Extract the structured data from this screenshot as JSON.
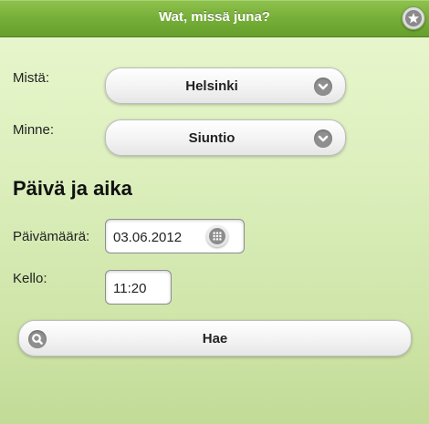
{
  "header": {
    "title": "Wat, missä juna?"
  },
  "form": {
    "from_label": "Mistä:",
    "from_value": "Helsinki",
    "to_label": "Minne:",
    "to_value": "Siuntio",
    "section_title": "Päivä ja aika",
    "date_label": "Päivämäärä:",
    "date_value": "03.06.2012",
    "time_label": "Kello:",
    "time_value": "11:20",
    "search_label": "Hae"
  },
  "icons": {
    "star": "star-icon",
    "chevron": "chevron-down-icon",
    "grid": "grid-icon",
    "search": "search-icon"
  },
  "colors": {
    "header": "#74ad37",
    "background": "#dcefbd"
  }
}
